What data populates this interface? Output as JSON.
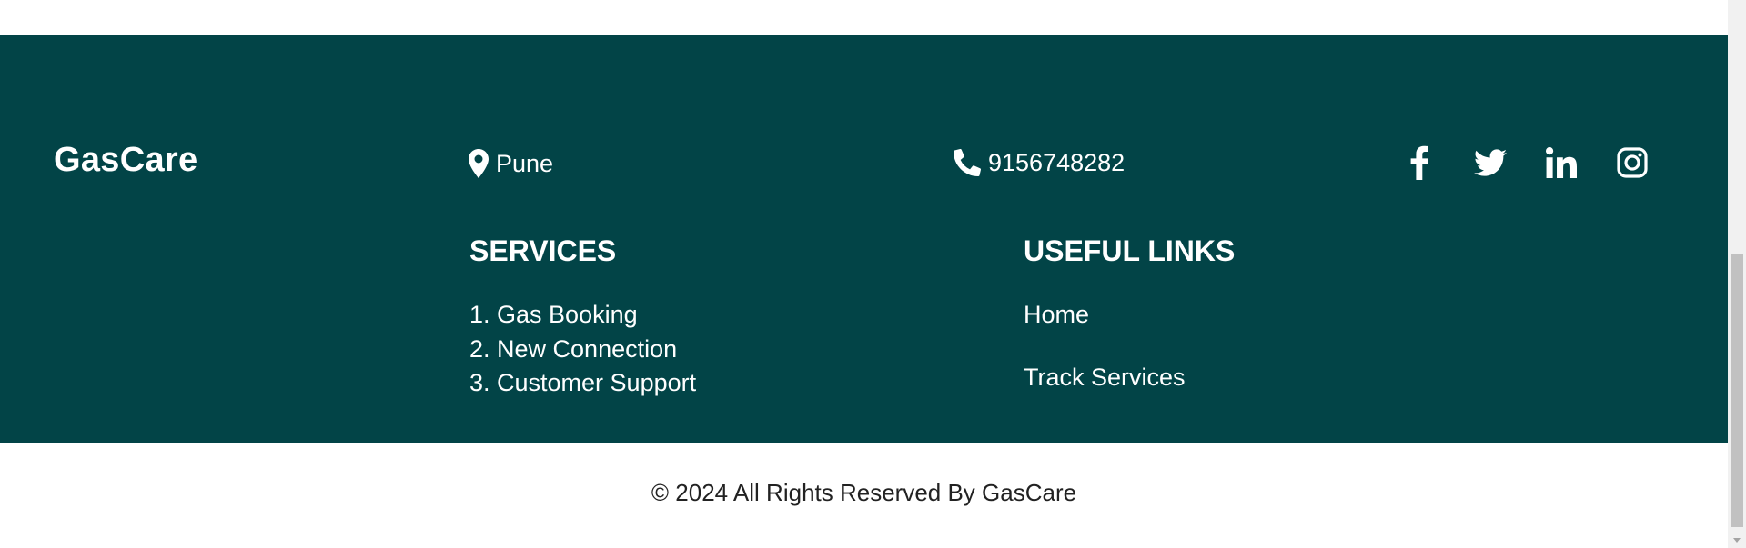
{
  "brand": {
    "name": "GasCare"
  },
  "contact": {
    "location": "Pune",
    "location_icon": "map-marker-icon",
    "phone": "9156748282",
    "phone_icon": "phone-icon"
  },
  "social": [
    {
      "name": "facebook",
      "icon": "facebook-icon"
    },
    {
      "name": "twitter",
      "icon": "twitter-icon"
    },
    {
      "name": "linkedin",
      "icon": "linkedin-icon"
    },
    {
      "name": "instagram",
      "icon": "instagram-icon"
    }
  ],
  "services": {
    "title": "SERVICES",
    "items": [
      "1. Gas Booking",
      "2. New Connection",
      "3. Customer Support"
    ]
  },
  "useful_links": {
    "title": "USEFUL LINKS",
    "items": [
      "Home",
      "Track Services"
    ]
  },
  "copyright": "© 2024 All Rights Reserved By GasCare",
  "colors": {
    "footer_bg": "#024447",
    "footer_text": "#ffffff",
    "page_bg": "#ffffff",
    "copyright_text": "#222222"
  }
}
